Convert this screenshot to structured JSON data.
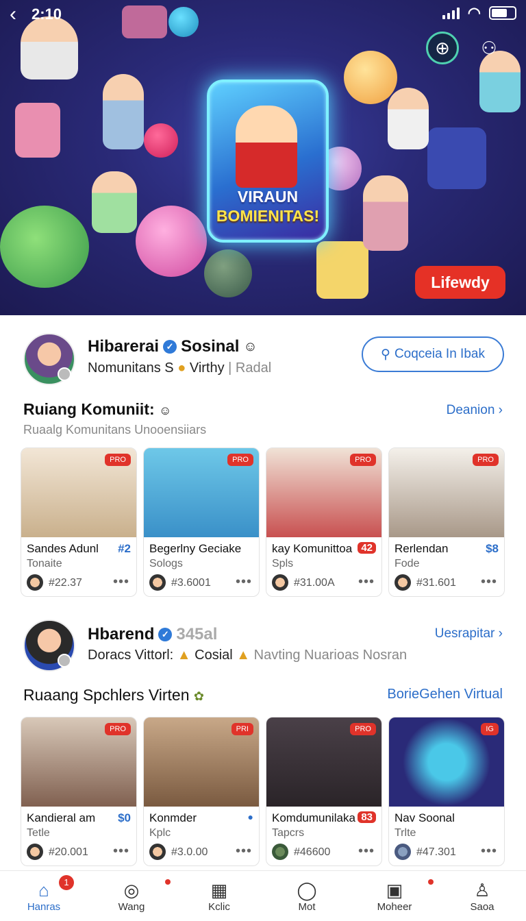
{
  "status_bar": {
    "time": "2:10"
  },
  "hero": {
    "phone_line1": "VIRAUN",
    "phone_line2": "BOMIENITAS!",
    "button_label": "Lifewdy"
  },
  "profile1": {
    "name": "Hibarerai",
    "name_suffix": "Sosinal",
    "subtitle": "Nomunitans S",
    "subtitle_b": "Virthy",
    "subtitle_muted": "| Radal",
    "action_label": "Coqceia In Ibak"
  },
  "section1": {
    "title": "Ruiang Komuniit:",
    "subtitle": "Ruaalg Komunitans Unooensiiars",
    "link": "Deanion"
  },
  "cards1": [
    {
      "tag": "PRO",
      "title": "Sandes Adunl",
      "badge": "#2",
      "sub": "Tonaite",
      "count": "#22.37"
    },
    {
      "tag": "PRO",
      "title": "Begerlny Geciake",
      "badge": "",
      "sub": "Sologs",
      "count": "#3.6001"
    },
    {
      "tag": "PRO",
      "title": "kay Komunittoa",
      "badge": "42",
      "sub": "Spls",
      "count": "#31.00A"
    },
    {
      "tag": "PRO",
      "title": "Rerlendan",
      "badge": "$8",
      "sub": "Fode",
      "count": "#31.601"
    }
  ],
  "profile2": {
    "name": "Hbarend",
    "name_suffix": "345al",
    "subtitle": "Doracs Vittorl:",
    "subtitle_b": "Cosial",
    "subtitle_muted": "Navting Nuarioas Nosran",
    "link": "Uesrapitar"
  },
  "section2": {
    "title": "Ruaang Spchlers Virten",
    "link": "BorieGehen Virtual"
  },
  "cards2": [
    {
      "tag": "PRO",
      "title": "Kandieral am",
      "badge": "$0",
      "sub": "Tetle",
      "count": "#20.001"
    },
    {
      "tag": "PRI",
      "title": "Konmder",
      "badge": "●",
      "sub": "Kplc",
      "count": "#3.0.00"
    },
    {
      "tag": "PRO",
      "title": "Komdumunilaka",
      "badge": "83",
      "sub": "Tapcrs",
      "count": "#46600"
    },
    {
      "tag": "IG",
      "title": "Nav Soonal",
      "badge": "",
      "sub": "Trlte",
      "count": "#47.301"
    }
  ],
  "nav": [
    {
      "label": "Hanras",
      "icon": "home-icon",
      "glyph": "⌂",
      "badge": "1"
    },
    {
      "label": "Wang",
      "icon": "camera-icon",
      "glyph": "◎",
      "badge": ""
    },
    {
      "label": "Kclic",
      "icon": "grid-icon",
      "glyph": "▦",
      "badge": ""
    },
    {
      "label": "Mot",
      "icon": "chat-icon",
      "glyph": "◯",
      "badge": ""
    },
    {
      "label": "Moheer",
      "icon": "store-icon",
      "glyph": "▣",
      "badge": ""
    },
    {
      "label": "Saoa",
      "icon": "profile-icon",
      "glyph": "♙",
      "badge": ""
    }
  ],
  "colors": {
    "accent": "#2c6ec9",
    "alert": "#e0332a",
    "hero_bg": "#2a2a78"
  }
}
